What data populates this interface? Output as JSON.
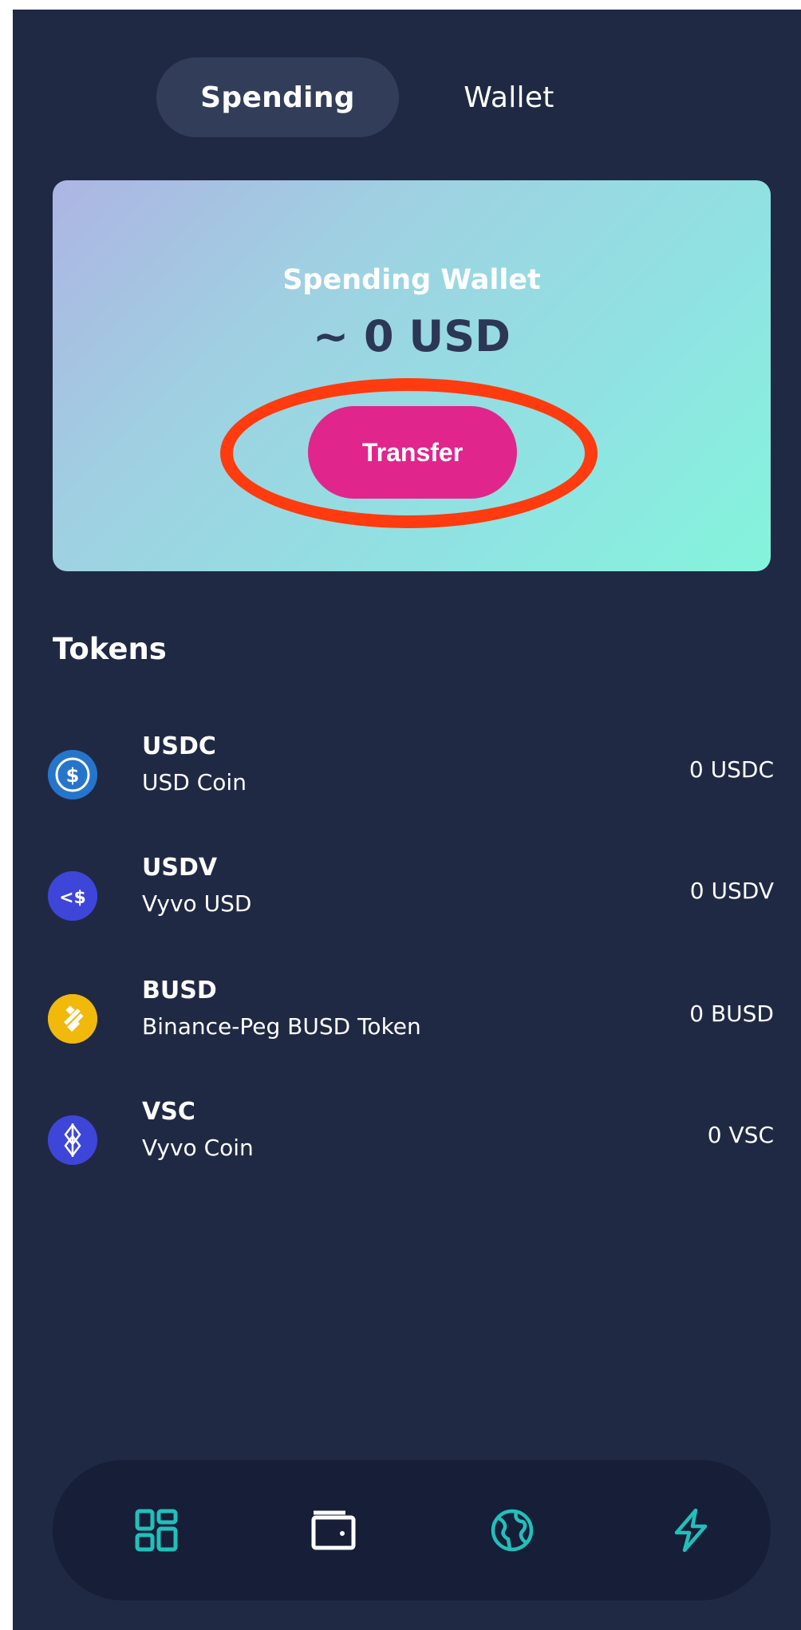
{
  "tabs": [
    {
      "label": "Spending",
      "active": true
    },
    {
      "label": "Wallet",
      "active": false
    }
  ],
  "card": {
    "title": "Spending Wallet",
    "amount": "~ 0 USD",
    "button_label": "Transfer"
  },
  "tokens": {
    "heading": "Tokens",
    "items": [
      {
        "symbol": "USDC",
        "name": "USD Coin",
        "balance": "0 USDC",
        "icon": "usdc-icon",
        "color": "#2775ca"
      },
      {
        "symbol": "USDV",
        "name": "Vyvo USD",
        "balance": "0 USDV",
        "icon": "usdv-icon",
        "color": "#3d46d8"
      },
      {
        "symbol": "BUSD",
        "name": "Binance-Peg BUSD Token",
        "balance": "0 BUSD",
        "icon": "busd-icon",
        "color": "#f0b90b"
      },
      {
        "symbol": "VSC",
        "name": "Vyvo Coin",
        "balance": "0 VSC",
        "icon": "vsc-icon",
        "color": "#3d46d8"
      }
    ]
  },
  "nav": {
    "items": [
      "dashboard-grid-icon",
      "wallet-icon",
      "globe-icon",
      "lightning-icon"
    ],
    "accent": "#21c0bb"
  },
  "colors": {
    "background": "#202944",
    "transfer_button": "#e0268c",
    "highlight": "#ff3b0f"
  }
}
